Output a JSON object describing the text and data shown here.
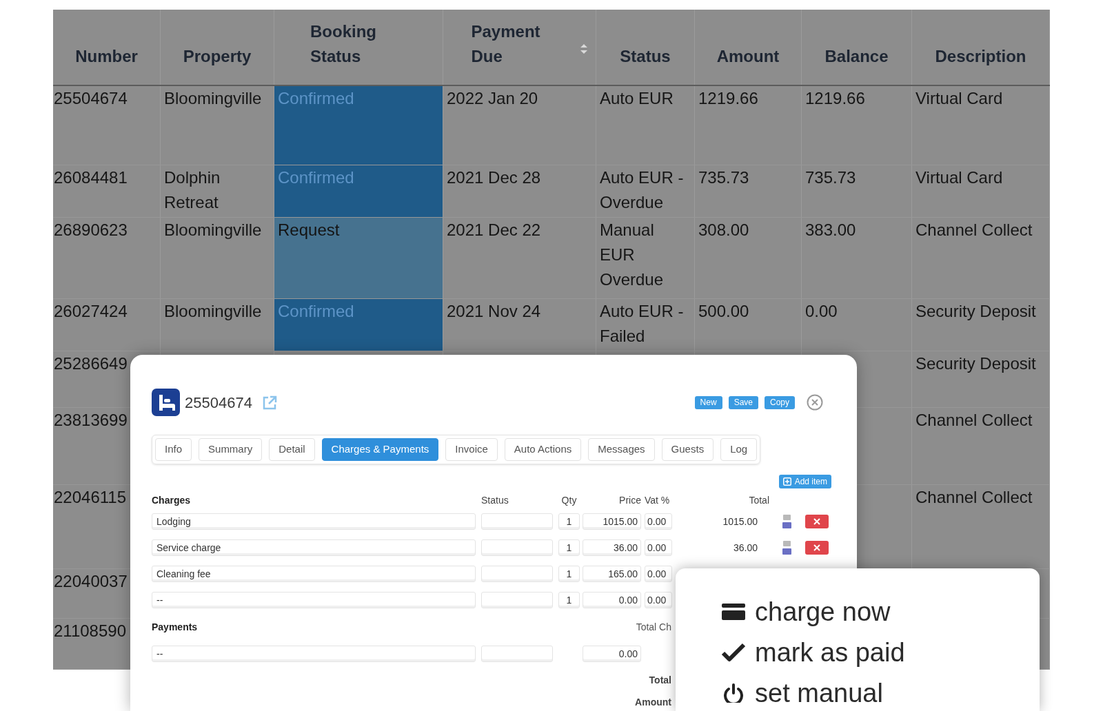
{
  "table": {
    "columns": [
      {
        "label": "Number",
        "sorted": false
      },
      {
        "label": "Property",
        "sorted": false
      },
      {
        "label": "Booking Status",
        "sorted": false
      },
      {
        "label": "Payment Due",
        "sorted": true
      },
      {
        "label": "Status",
        "sorted": false
      },
      {
        "label": "Amount",
        "sorted": false
      },
      {
        "label": "Balance",
        "sorted": false
      },
      {
        "label": "Description",
        "sorted": false
      }
    ],
    "rows": [
      {
        "number": "25504674",
        "property": "Bloomingville",
        "booking_status": {
          "label": "Confirmed",
          "color": "#1f5b89"
        },
        "payment_due": "2022 Jan 20",
        "status": "Auto EUR",
        "amount": "1219.66",
        "balance": "1219.66",
        "description": "Virtual Card"
      },
      {
        "number": "26084481",
        "property": "Dolphin Retreat",
        "booking_status": {
          "label": "Confirmed",
          "color": "#1f5b89"
        },
        "payment_due": "2021 Dec 28",
        "status": "Auto EUR - Overdue",
        "amount": "735.73",
        "balance": "735.73",
        "description": "Virtual Card"
      },
      {
        "number": "26890623",
        "property": "Bloomingville",
        "booking_status": {
          "label": "Request",
          "color": "#46728f"
        },
        "payment_due": "2021 Dec 22",
        "status": "Manual EUR Overdue",
        "amount": "308.00",
        "balance": "383.00",
        "description": "Channel Collect"
      },
      {
        "number": "26027424",
        "property": "Bloomingville",
        "booking_status": {
          "label": "Confirmed",
          "color": "#1f5b89"
        },
        "payment_due": "2021 Nov 24",
        "status": "Auto EUR - Failed",
        "amount": "500.00",
        "balance": "0.00",
        "description": "Security Deposit"
      },
      {
        "number": "25286649",
        "description": "Security Deposit"
      },
      {
        "number": "23813699",
        "description": "Channel Collect"
      },
      {
        "number": "22046115",
        "description": "Channel Collect"
      },
      {
        "number": "22040037"
      },
      {
        "number": "21108590"
      }
    ]
  },
  "booking_modal": {
    "booking_number": "25504674",
    "header_buttons": [
      "New",
      "Save",
      "Copy"
    ],
    "tabs": [
      {
        "label": "Info",
        "selected": false
      },
      {
        "label": "Summary",
        "selected": false
      },
      {
        "label": "Detail",
        "selected": false
      },
      {
        "label": "Charges & Payments",
        "selected": true
      },
      {
        "label": "Invoice",
        "selected": false
      },
      {
        "label": "Auto Actions",
        "selected": false
      },
      {
        "label": "Messages",
        "selected": false
      },
      {
        "label": "Guests",
        "selected": false
      },
      {
        "label": "Log",
        "selected": false
      }
    ],
    "add_button": "Add item",
    "charges": {
      "title": "Charges",
      "columns": [
        "Status",
        "Qty",
        "Price",
        "Vat %",
        "Total"
      ],
      "rows": [
        {
          "description": "Lodging",
          "qty": "1",
          "price": "1015.00",
          "vat": "0.00",
          "total": "1015.00"
        },
        {
          "description": "Service charge",
          "qty": "1",
          "price": "36.00",
          "vat": "0.00",
          "total": "36.00"
        },
        {
          "description": "Cleaning fee",
          "qty": "1",
          "price": "165.00",
          "vat": "0.00"
        },
        {
          "description": "--",
          "qty": "1",
          "price": "0.00",
          "vat": "0.00"
        }
      ]
    },
    "payments": {
      "title": "Payments",
      "total_label": "Total Ch",
      "rows": [
        {
          "description": "--",
          "amount": "0.00"
        }
      ]
    },
    "totals": [
      "Total",
      "Amount"
    ]
  },
  "context_menu": {
    "items": [
      {
        "kind": "card",
        "label": "charge now"
      },
      {
        "kind": "check",
        "label": "mark as paid"
      },
      {
        "kind": "power",
        "label": "set manual"
      }
    ]
  }
}
